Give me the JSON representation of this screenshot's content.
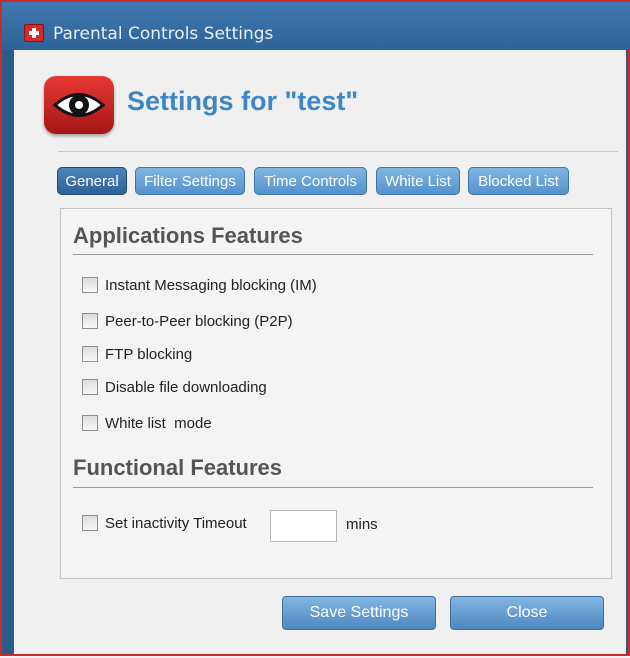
{
  "window": {
    "title": "Parental Controls Settings"
  },
  "header": {
    "title": "Settings for \"test\""
  },
  "tabs": [
    {
      "label": "General",
      "active": true
    },
    {
      "label": "Filter Settings",
      "active": false
    },
    {
      "label": "Time Controls",
      "active": false
    },
    {
      "label": "White List",
      "active": false
    },
    {
      "label": "Blocked List",
      "active": false
    }
  ],
  "applications": {
    "title": "Applications Features",
    "options": [
      {
        "label": "Instant Messaging blocking (IM)",
        "checked": false
      },
      {
        "label": "Peer-to-Peer blocking (P2P)",
        "checked": false
      },
      {
        "label": "FTP blocking",
        "checked": false
      },
      {
        "label": "Disable file downloading",
        "checked": false
      },
      {
        "label": "White list  mode",
        "checked": false
      }
    ]
  },
  "functional": {
    "title": "Functional Features",
    "timeout": {
      "label": "Set inactivity Timeout",
      "checked": false,
      "value": "",
      "unit": "mins"
    }
  },
  "buttons": {
    "save": "Save Settings",
    "close": "Close"
  },
  "colors": {
    "titlebar": "#2e6397",
    "accent": "#3e86c6",
    "frame_border": "#cc2a2a",
    "logo": "#d42a2a"
  },
  "icons": {
    "app_icon": "swiss-cross-icon",
    "logo": "eye-icon"
  }
}
